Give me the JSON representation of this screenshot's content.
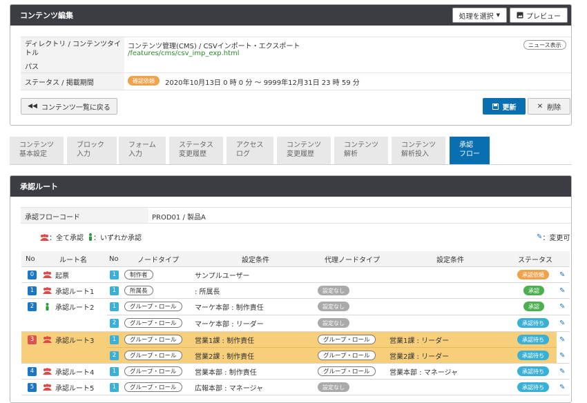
{
  "top": {
    "title": "コンテンツ編集",
    "process_select": "処理を選択",
    "preview": "プレビュー",
    "dir_label": "ディレクトリ / コンテンツタイトル",
    "path_label": "パス",
    "dir_value": "コンテンツ管理(CMS) / CSVインポート・エクスポート",
    "path_value": "/features/cms/csv_imp_exp.html",
    "news_button": "ニュース表示",
    "status_label": "ステータス / 掲載期間",
    "status_badge": "確認依頼",
    "period": "2020年10月13日 0 時  0 分 〜 9999年12月31日 23 時  59 分",
    "back_button": "コンテンツ一覧に戻る",
    "update_button": "更新",
    "delete_button": "削除"
  },
  "tabs": [
    {
      "line1": "コンテンツ",
      "line2": "基本設定"
    },
    {
      "line1": "ブロック",
      "line2": "入力"
    },
    {
      "line1": "フォーム",
      "line2": "入力"
    },
    {
      "line1": "ステータス",
      "line2": "変更履歴"
    },
    {
      "line1": "アクセス",
      "line2": "ログ"
    },
    {
      "line1": "コンテンツ",
      "line2": "変更履歴"
    },
    {
      "line1": "コンテンツ",
      "line2": "解析"
    },
    {
      "line1": "コンテンツ",
      "line2": "解析投入"
    },
    {
      "line1": "承認",
      "line2": "フロー"
    }
  ],
  "approval": {
    "title": "承認ルート",
    "flow_code_label": "承認フローコード",
    "flow_code_value": "PROD01 /  製品A",
    "legend_all": "：全て承認",
    "legend_any": "：いずれか承認",
    "legend_editable": "：変更可",
    "headers": {
      "no": "No",
      "route": "ルート名",
      "node_no": "No",
      "node_type": "ノードタイプ",
      "setting": "設定条件",
      "proxy_type": "代理ノードタイプ",
      "proxy_setting": "設定条件",
      "status": "ステータス"
    },
    "rows": [
      {
        "no": "0",
        "route": "起票",
        "node_no": "1",
        "node_type": "制作者",
        "setting": "サンプルユーザー",
        "proxy": "",
        "proxy_setting": "",
        "status": "承認依頼"
      },
      {
        "no": "1",
        "route": "承認ルート1",
        "node_no": "1",
        "node_type": "所属長",
        "setting": ": 所属長",
        "proxy": "設定なし",
        "proxy_setting": "",
        "status": "承認"
      },
      {
        "no": "2",
        "route": "承認ルート2",
        "node_no": "1",
        "node_type": "グループ・ロール",
        "setting": "マーケ本部 : 制作責任",
        "proxy": "設定なし",
        "proxy_setting": "",
        "status": "承認"
      },
      {
        "no": "",
        "route": "",
        "node_no": "2",
        "node_type": "グループ・ロール",
        "setting": "マーケ本部 : リーダー",
        "proxy": "設定なし",
        "proxy_setting": "",
        "status": "承認待ち"
      },
      {
        "no": "3",
        "route": "承認ルート3",
        "node_no": "1",
        "node_type": "グループ・ロール",
        "setting": "営業1課 : 制作責任",
        "proxy": "グループ・ロール",
        "proxy_setting": "営業1課 : リーダー",
        "status": "承認待ち"
      },
      {
        "no": "",
        "route": "",
        "node_no": "2",
        "node_type": "グループ・ロール",
        "setting": "営業2課 : 制作責任",
        "proxy": "グループ・ロール",
        "proxy_setting": "営業2課 : リーダー",
        "status": "承認待ち"
      },
      {
        "no": "4",
        "route": "承認ルート4",
        "node_no": "1",
        "node_type": "グループ・ロール",
        "setting": "営業本部 : 制作責任",
        "proxy": "グループ・ロール",
        "proxy_setting": "営業本部 : マネージャ",
        "status": "承認待ち"
      },
      {
        "no": "5",
        "route": "承認ルート5",
        "node_no": "1",
        "node_type": "グループ・ロール",
        "setting": "広報本部 : マネージャ",
        "proxy": "設定なし",
        "proxy_setting": "",
        "status": "承認待ち"
      }
    ]
  },
  "colors": {
    "dark_header": "#3c3d43",
    "primary_blue": "#0a6fb1",
    "highlight": "#f7cf7b",
    "orange": "#f0a24b",
    "green": "#4caf50",
    "teal": "#3bb0d6",
    "gray_pill": "#aaaaaa",
    "red_num": "#d9534f",
    "number_blue": "#1b76c5"
  }
}
